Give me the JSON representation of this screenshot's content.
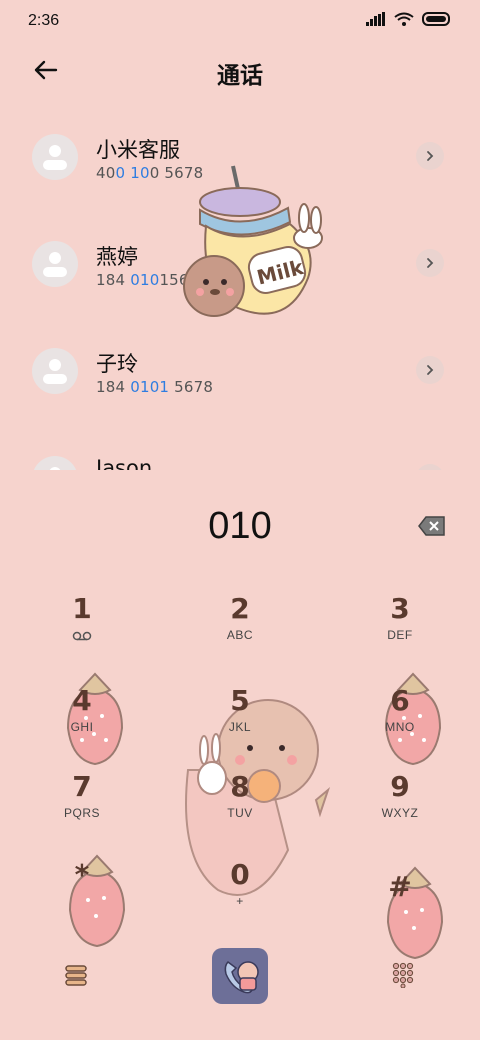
{
  "status": {
    "time": "2:36"
  },
  "header": {
    "title": "通话"
  },
  "contacts": [
    {
      "name": "小米客服",
      "number_parts": [
        "40",
        "0 10",
        "0 5678"
      ],
      "highlight_index": 1
    },
    {
      "name": "燕婷",
      "number_parts": [
        "184 ",
        "010",
        "15689"
      ],
      "highlight_index": 1
    },
    {
      "name": "子玲",
      "number_parts": [
        "184 ",
        "0101",
        " 5678"
      ],
      "highlight_index": 1
    },
    {
      "name": "Jason",
      "number_parts": [
        "",
        "",
        ""
      ],
      "highlight_index": 1
    }
  ],
  "dialer": {
    "entered_number": "010",
    "keys": [
      {
        "digit": "1",
        "letters": ""
      },
      {
        "digit": "2",
        "letters": "ABC"
      },
      {
        "digit": "3",
        "letters": "DEF"
      },
      {
        "digit": "4",
        "letters": "GHI"
      },
      {
        "digit": "5",
        "letters": "JKL"
      },
      {
        "digit": "6",
        "letters": "MNO"
      },
      {
        "digit": "7",
        "letters": "PQRS"
      },
      {
        "digit": "8",
        "letters": "TUV"
      },
      {
        "digit": "9",
        "letters": "WXYZ"
      },
      {
        "digit": "*",
        "letters": ""
      },
      {
        "digit": "0",
        "letters": "+"
      },
      {
        "digit": "#",
        "letters": ""
      }
    ]
  },
  "decorations": {
    "milk_label": "Milk"
  },
  "icons": {
    "status": [
      "signal-icon",
      "wifi-icon",
      "battery-icon"
    ],
    "header": "back-arrow-icon",
    "contact_action": "chevron-right-icon",
    "backspace": "backspace-icon",
    "voicemail": "voicemail-icon",
    "bottom": [
      "menu-icon",
      "call-icon",
      "dialpad-grid-icon"
    ]
  },
  "colors": {
    "background": "#f6d3cd",
    "highlight": "#2f7de1",
    "key_digit": "#5a3a2e"
  }
}
